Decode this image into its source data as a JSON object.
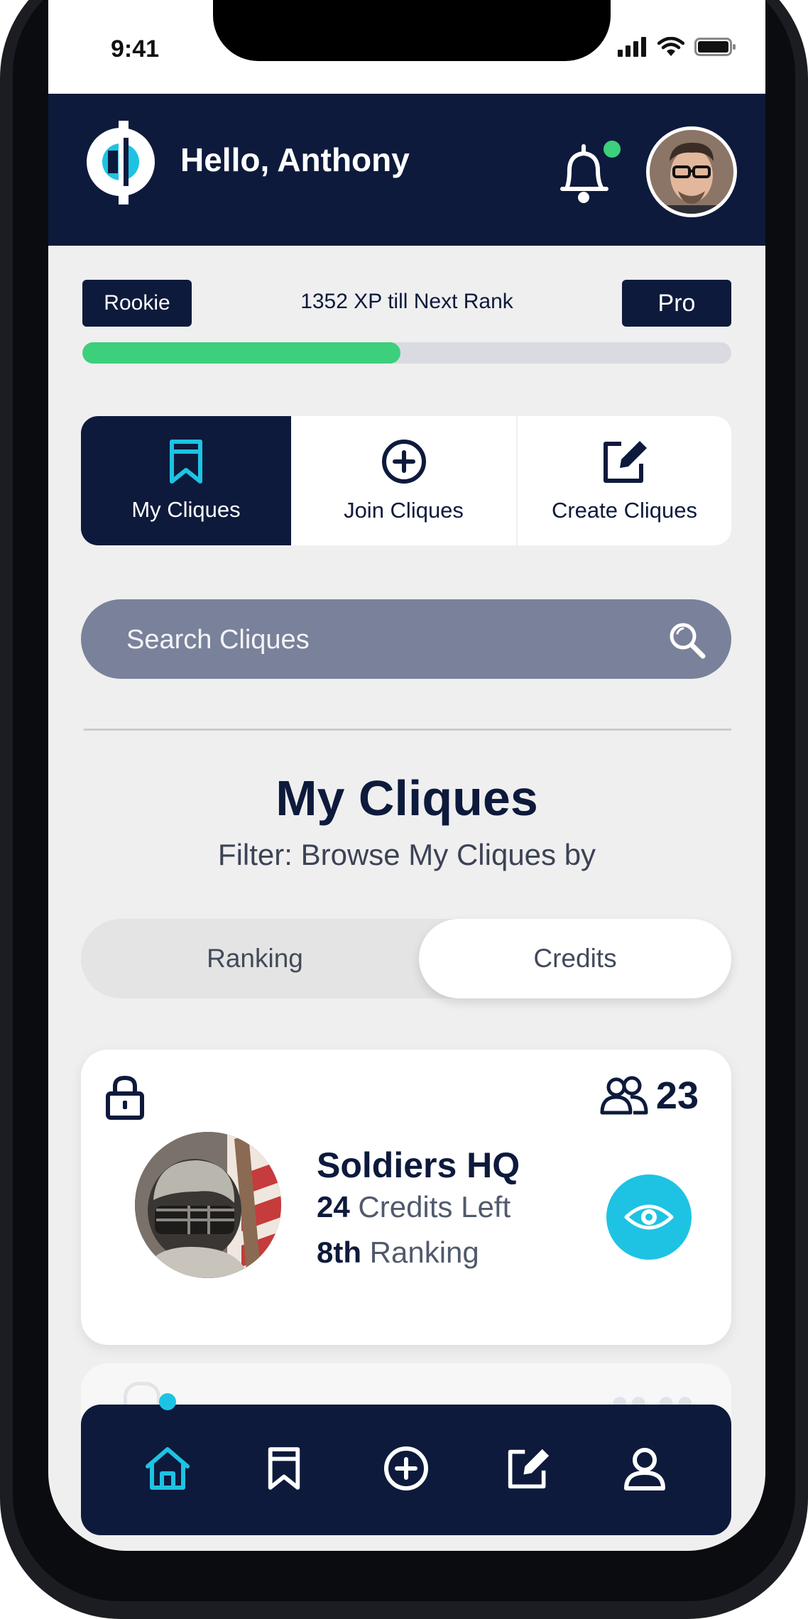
{
  "status_bar": {
    "time": "9:41"
  },
  "header": {
    "greeting": "Hello, Anthony",
    "notification_dot_color": "#3ccf7c",
    "brand_color": "#0d1a3c"
  },
  "rank": {
    "current": "Rookie",
    "next": "Pro",
    "xp_text": "1352 XP till Next Rank",
    "progress_percent": 49
  },
  "tabs": [
    {
      "label": "My Cliques",
      "icon": "bookmark-icon",
      "active": true
    },
    {
      "label": "Join Cliques",
      "icon": "plus-circle-icon",
      "active": false
    },
    {
      "label": "Create Cliques",
      "icon": "edit-square-icon",
      "active": false
    }
  ],
  "search": {
    "placeholder": "Search Cliques"
  },
  "section": {
    "title": "My Cliques",
    "subtitle": "Filter: Browse My Cliques by"
  },
  "filter": {
    "options": [
      "Ranking",
      "Credits"
    ],
    "selected": "Credits"
  },
  "cliques": [
    {
      "name": "Soldiers HQ",
      "members": "23",
      "credits_value": "24",
      "credits_label": " Credits Left",
      "ranking_value": "8th",
      "ranking_label": " Ranking",
      "locked": true,
      "accent": "#1ec3e3"
    }
  ],
  "bottom_nav": {
    "items": [
      "home-icon",
      "bookmark-icon",
      "plus-circle-icon",
      "edit-square-icon",
      "user-icon"
    ],
    "active": "home-icon",
    "active_color": "#1ec3e3"
  }
}
